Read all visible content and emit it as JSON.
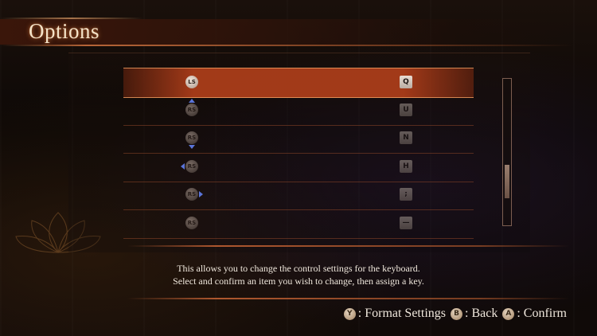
{
  "header": {
    "title": "Options"
  },
  "rows": [
    {
      "stick": "LS",
      "direction": "none",
      "key": "Q",
      "selected": true
    },
    {
      "stick": "RS",
      "direction": "up",
      "key": "U",
      "selected": false
    },
    {
      "stick": "RS",
      "direction": "down",
      "key": "N",
      "selected": false
    },
    {
      "stick": "RS",
      "direction": "left",
      "key": "H",
      "selected": false
    },
    {
      "stick": "RS",
      "direction": "right",
      "key": ";",
      "selected": false
    },
    {
      "stick": "RS",
      "direction": "none",
      "key": "—",
      "selected": false
    }
  ],
  "description": {
    "line1": "This allows you to change the control settings for the keyboard.",
    "line2": "Select and confirm an item you wish to change, then assign a key."
  },
  "footer": {
    "format": {
      "button": "Y",
      "label": ": Format Settings"
    },
    "back": {
      "button": "B",
      "label": ": Back"
    },
    "confirm": {
      "button": "A",
      "label": ": Confirm"
    }
  },
  "colors": {
    "accent": "#aa3c19",
    "highlight_line": "#f0a064",
    "text": "#efe7dc",
    "direction_arrow": "#5a74d8"
  }
}
